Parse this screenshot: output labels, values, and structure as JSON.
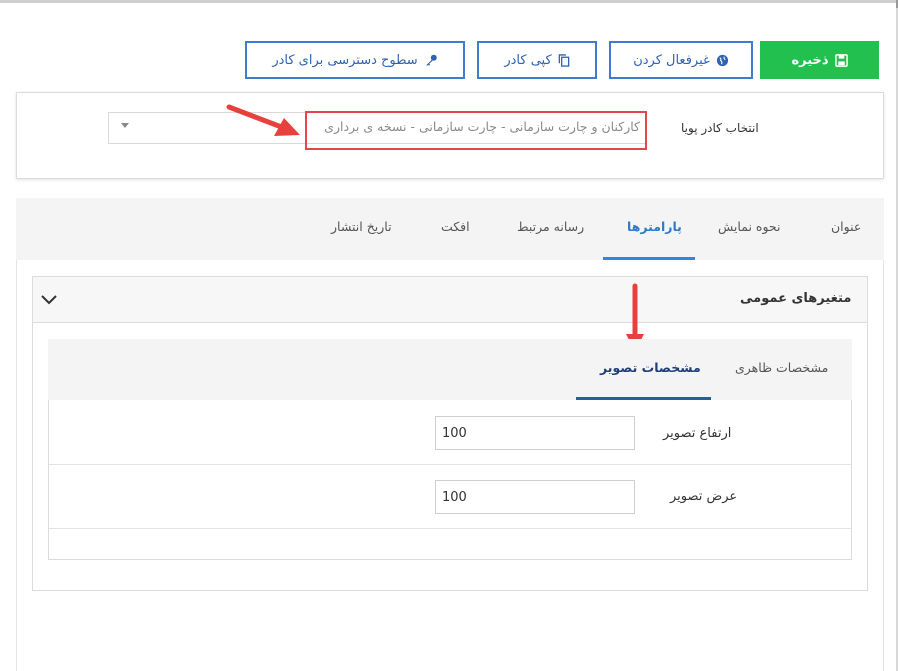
{
  "toolbar": {
    "save_label": "ذخیره",
    "deactivate_label": "غیرفعال کردن",
    "copy_label": "کپی کادر",
    "access_levels_label": "سطوح دسترسی برای کادر"
  },
  "frame_select": {
    "label": "انتخاب کادر پویا",
    "value": "کارکنان و چارت سازمانی - چارت سازمانی - نسخه ی برداری"
  },
  "tabs": [
    {
      "label": "عنوان"
    },
    {
      "label": "نحوه نمایش"
    },
    {
      "label": "پارامترها"
    },
    {
      "label": "رسانه مرتبط"
    },
    {
      "label": "افکت"
    },
    {
      "label": "تاریخ انتشار"
    }
  ],
  "accordion": {
    "title": "متغیرهای عمومی"
  },
  "inner_tabs": [
    {
      "label": "مشخصات ظاهری"
    },
    {
      "label": "مشخصات تصویر"
    }
  ],
  "fields": {
    "height": {
      "label": "ارتفاع تصویر",
      "value": "100"
    },
    "width": {
      "label": "عرض تصویر",
      "value": "100"
    }
  },
  "colors": {
    "accent_blue": "#3f7bd1",
    "save_green": "#22c04f",
    "annotation_red": "#e2474b"
  }
}
